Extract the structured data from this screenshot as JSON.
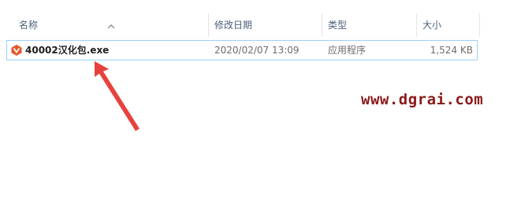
{
  "columns": {
    "name": "名称",
    "date": "修改日期",
    "type": "类型",
    "size": "大小"
  },
  "file": {
    "name": "40002汉化包.exe",
    "date": "2020/02/07 13:09",
    "type": "应用程序",
    "size": "1,524 KB",
    "icon": "app-icon"
  },
  "watermark": "www.dgrai.com",
  "colors": {
    "selection_border": "#99d1ff",
    "arrow": "#e8423e",
    "watermark": "#8b1a1a",
    "header_text": "#4c607a"
  }
}
